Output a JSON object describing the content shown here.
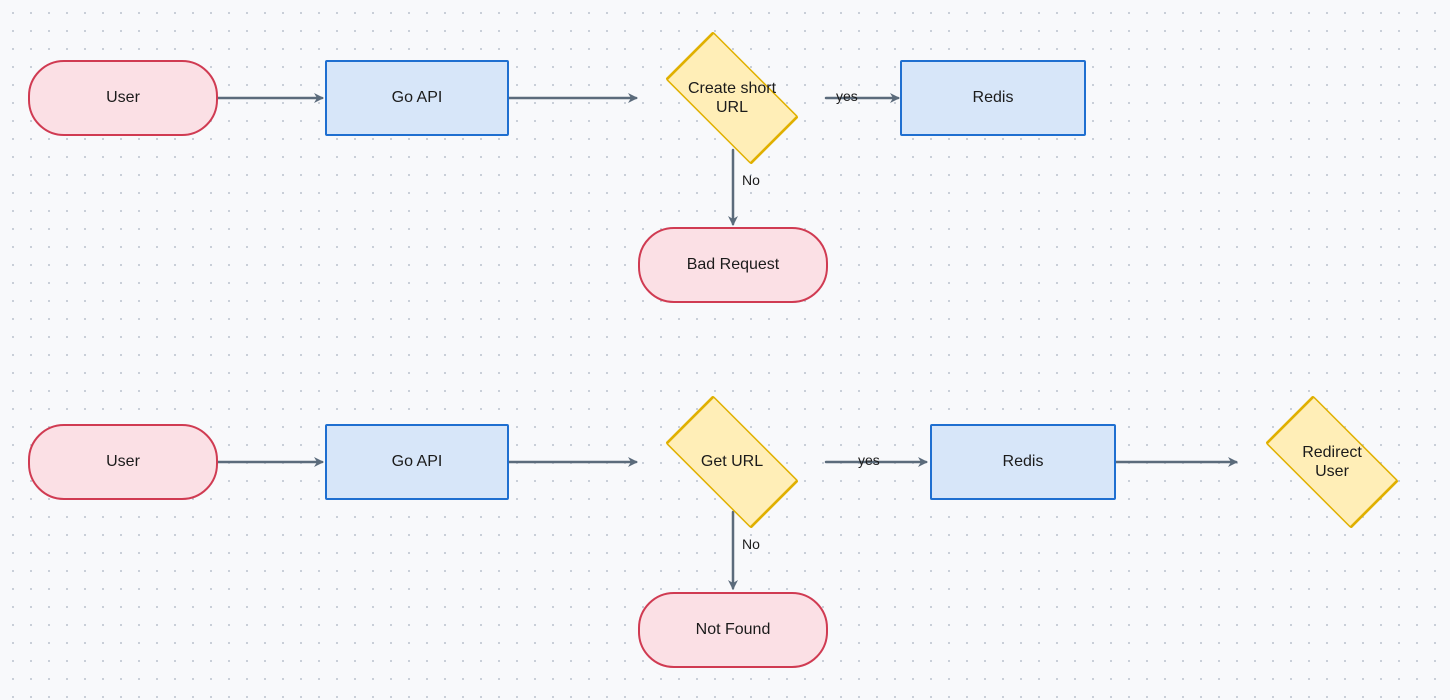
{
  "flow1": {
    "user": "User",
    "api": "Go API",
    "decision": "Create short\nURL",
    "yes_label": "yes",
    "no_label": "No",
    "redis": "Redis",
    "bad": "Bad Request"
  },
  "flow2": {
    "user": "User",
    "api": "Go API",
    "decision": "Get URL",
    "yes_label": "yes",
    "no_label": "No",
    "redis": "Redis",
    "redirect": "Redirect\nUser",
    "notfound": "Not Found"
  }
}
